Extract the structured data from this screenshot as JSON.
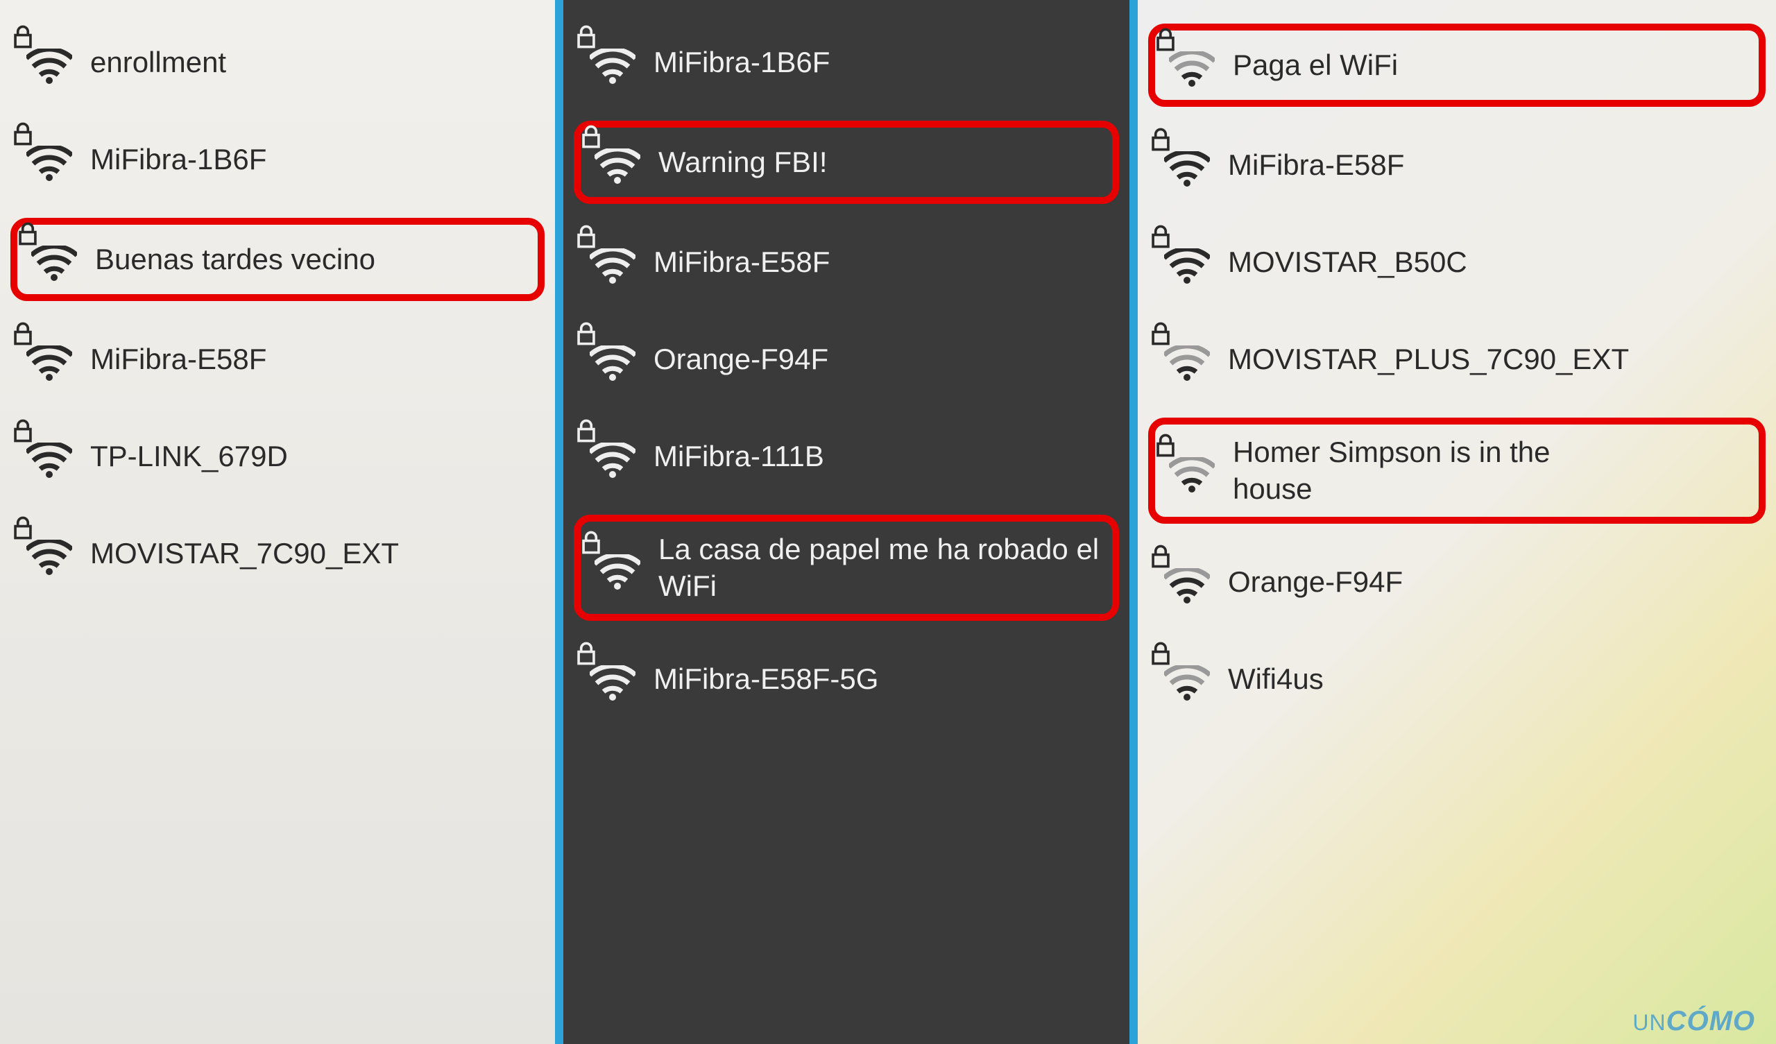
{
  "panels": {
    "left": {
      "items": [
        {
          "name": "enrollment",
          "locked": true,
          "highlighted": false
        },
        {
          "name": "MiFibra-1B6F",
          "locked": true,
          "highlighted": false
        },
        {
          "name": "Buenas tardes vecino",
          "locked": true,
          "highlighted": true
        },
        {
          "name": "MiFibra-E58F",
          "locked": true,
          "highlighted": false
        },
        {
          "name": "TP-LINK_679D",
          "locked": true,
          "highlighted": false
        },
        {
          "name": "MOVISTAR_7C90_EXT",
          "locked": true,
          "highlighted": false
        }
      ]
    },
    "center": {
      "items": [
        {
          "name": "MiFibra-1B6F",
          "locked": true,
          "highlighted": false
        },
        {
          "name": "Warning FBI!",
          "locked": true,
          "highlighted": true
        },
        {
          "name": "MiFibra-E58F",
          "locked": true,
          "highlighted": false
        },
        {
          "name": "Orange-F94F",
          "locked": true,
          "highlighted": false
        },
        {
          "name": "MiFibra-111B",
          "locked": true,
          "highlighted": false
        },
        {
          "name": "La casa de papel me ha robado el WiFi",
          "locked": true,
          "highlighted": true,
          "wrap": true
        },
        {
          "name": "MiFibra-E58F-5G",
          "locked": true,
          "highlighted": false
        }
      ]
    },
    "right": {
      "items": [
        {
          "name": "Paga el WiFi",
          "locked": true,
          "highlighted": true
        },
        {
          "name": "MiFibra-E58F",
          "locked": true,
          "highlighted": false
        },
        {
          "name": "MOVISTAR_B50C",
          "locked": true,
          "highlighted": false
        },
        {
          "name": "MOVISTAR_PLUS_7C90_EXT",
          "locked": true,
          "highlighted": false
        },
        {
          "name": "Homer Simpson is in the house",
          "locked": true,
          "highlighted": true,
          "wrap": true
        },
        {
          "name": "Orange-F94F",
          "locked": true,
          "highlighted": false
        },
        {
          "name": "Wifi4us",
          "locked": true,
          "highlighted": false
        }
      ]
    }
  },
  "watermark": {
    "prefix": "UN",
    "suffix": "CÓMO"
  },
  "colors": {
    "highlight_border": "#e60000",
    "accent_blue": "#2ba3d8"
  }
}
